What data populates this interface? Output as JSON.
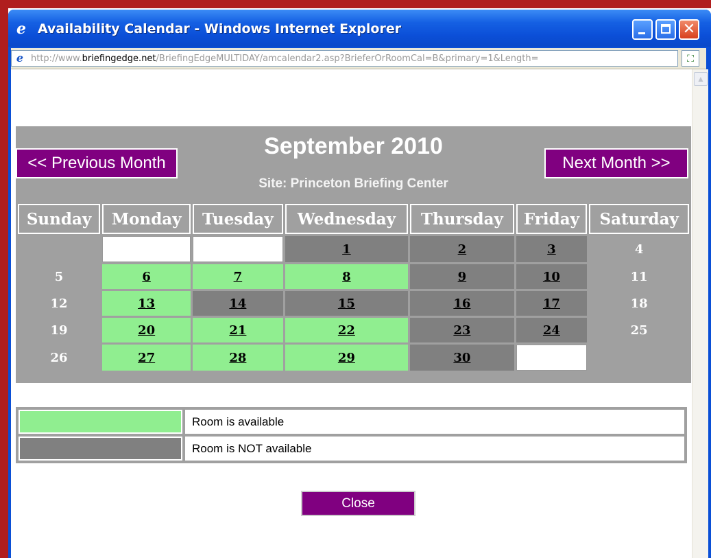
{
  "window": {
    "title": "Availability Calendar - Windows Internet Explorer",
    "icon": "ie-logo-icon"
  },
  "address": {
    "url_prefix": "http://www.",
    "url_domain": "briefingedge.net",
    "url_rest": "/BriefingEdgeMULTIDAY/amcalendar2.asp?BrieferOrRoomCal=B&primary=1&Length="
  },
  "calendar": {
    "month_title": "September 2010",
    "site_line": "Site: Princeton Briefing Center",
    "prev_label": "<< Previous Month",
    "next_label": "Next Month >>",
    "weekdays": [
      "Sunday",
      "Monday",
      "Tuesday",
      "Wednesday",
      "Thursday",
      "Friday",
      "Saturday"
    ],
    "weeks": [
      [
        {
          "day": "",
          "status": "blank"
        },
        {
          "day": "",
          "status": "empty"
        },
        {
          "day": "",
          "status": "empty"
        },
        {
          "day": "1",
          "status": "not"
        },
        {
          "day": "2",
          "status": "not"
        },
        {
          "day": "3",
          "status": "not"
        },
        {
          "day": "4",
          "status": "weekend"
        }
      ],
      [
        {
          "day": "5",
          "status": "weekend"
        },
        {
          "day": "6",
          "status": "avail"
        },
        {
          "day": "7",
          "status": "avail"
        },
        {
          "day": "8",
          "status": "avail"
        },
        {
          "day": "9",
          "status": "not"
        },
        {
          "day": "10",
          "status": "not"
        },
        {
          "day": "11",
          "status": "weekend"
        }
      ],
      [
        {
          "day": "12",
          "status": "weekend"
        },
        {
          "day": "13",
          "status": "avail"
        },
        {
          "day": "14",
          "status": "not"
        },
        {
          "day": "15",
          "status": "not"
        },
        {
          "day": "16",
          "status": "not"
        },
        {
          "day": "17",
          "status": "not"
        },
        {
          "day": "18",
          "status": "weekend"
        }
      ],
      [
        {
          "day": "19",
          "status": "weekend"
        },
        {
          "day": "20",
          "status": "avail"
        },
        {
          "day": "21",
          "status": "avail"
        },
        {
          "day": "22",
          "status": "avail"
        },
        {
          "day": "23",
          "status": "not"
        },
        {
          "day": "24",
          "status": "not"
        },
        {
          "day": "25",
          "status": "weekend"
        }
      ],
      [
        {
          "day": "26",
          "status": "weekend"
        },
        {
          "day": "27",
          "status": "avail"
        },
        {
          "day": "28",
          "status": "avail"
        },
        {
          "day": "29",
          "status": "avail"
        },
        {
          "day": "30",
          "status": "not"
        },
        {
          "day": "",
          "status": "empty"
        },
        {
          "day": "",
          "status": "blank"
        }
      ]
    ]
  },
  "legend": {
    "available_label": "Room is available",
    "not_available_label": "Room is NOT available",
    "available_color": "#90ee90",
    "not_available_color": "#808080"
  },
  "close_label": "Close",
  "colors": {
    "header_gray": "#a0a0a0",
    "button_purple": "#800080",
    "titlebar_blue": "#0a4fd6"
  }
}
